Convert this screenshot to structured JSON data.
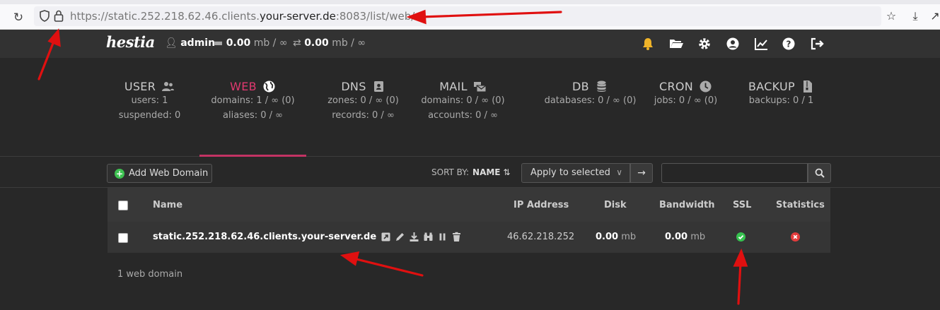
{
  "browser": {
    "url_prefix": "https://static.252.218.62.46.clients.",
    "url_domain": "your-server.de",
    "url_suffix": ":8083/list/web/"
  },
  "topbar": {
    "logo": "hestia",
    "user": "admin",
    "disk_value": "0.00",
    "disk_unit": "mb / ∞",
    "bandwidth_value": "0.00",
    "bandwidth_unit": "mb / ∞"
  },
  "overview": {
    "tabs": [
      {
        "title": "USER",
        "lines": [
          "users: 1",
          "suspended: 0"
        ]
      },
      {
        "title": "WEB",
        "lines": [
          "domains: 1 / ∞ (0)",
          "aliases: 0 / ∞"
        ]
      },
      {
        "title": "DNS",
        "lines": [
          "zones: 0 / ∞ (0)",
          "records: 0 / ∞"
        ]
      },
      {
        "title": "MAIL",
        "lines": [
          "domains: 0 / ∞ (0)",
          "accounts: 0 / ∞"
        ]
      },
      {
        "title": "DB",
        "lines": [
          "databases: 0 / ∞ (0)"
        ]
      },
      {
        "title": "CRON",
        "lines": [
          "jobs: 0 / ∞ (0)"
        ]
      },
      {
        "title": "BACKUP",
        "lines": [
          "backups: 0 / 1"
        ]
      }
    ]
  },
  "toolbar": {
    "add_label": "Add Web Domain",
    "sort_label": "SORT BY:",
    "sort_value": "NAME",
    "apply_label": "Apply to selected",
    "search_value": ""
  },
  "table": {
    "headers": {
      "name": "Name",
      "ip": "IP Address",
      "disk": "Disk",
      "bandwidth": "Bandwidth",
      "ssl": "SSL",
      "statistics": "Statistics"
    },
    "rows": [
      {
        "name": "static.252.218.62.46.clients.your-server.de",
        "ip": "46.62.218.252",
        "disk_value": "0.00",
        "disk_unit": "mb",
        "bandwidth_value": "0.00",
        "bandwidth_unit": "mb",
        "ssl": "enabled",
        "statistics": "disabled"
      }
    ]
  },
  "footer": {
    "count": "1 web domain"
  },
  "colors": {
    "accent": "#c33363",
    "ok": "#36c24f",
    "error": "#e33c3c",
    "annotation": "#e01010"
  }
}
